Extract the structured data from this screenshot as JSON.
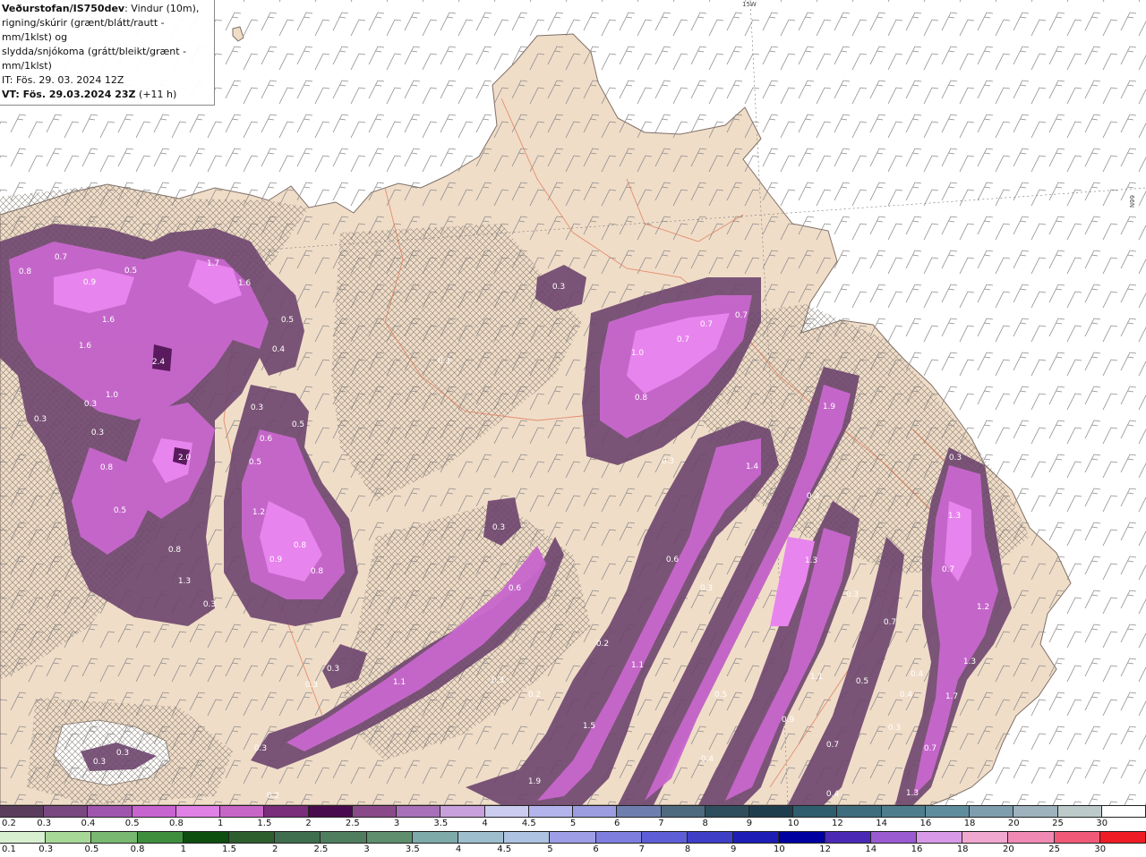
{
  "header": {
    "title": "Veðurstofan/IS750dev",
    "desc1": ": Vindur (10m),",
    "desc2": "rigning/skúrir (grænt/blátt/rautt - mm/1klst) og",
    "desc3": "slydda/snjókoma (grátt/bleikt/grænt - mm/1klst)",
    "it": "IT: Fös. 29. 03. 2024 12Z",
    "vt_label": "VT: Fös. 29.03.2024 23Z",
    "vt_lead": "(+11 h)"
  },
  "grid_labels": {
    "lon": "15W",
    "lat": "66N"
  },
  "precip_values": [
    {
      "v": "0.8"
    },
    {
      "v": "0.7"
    },
    {
      "v": "0.5"
    },
    {
      "v": "0.9"
    },
    {
      "v": "1.7"
    },
    {
      "v": "1.6"
    },
    {
      "v": "1.6"
    },
    {
      "v": "1.6"
    },
    {
      "v": "0.5"
    },
    {
      "v": "0.4"
    },
    {
      "v": "2.4"
    },
    {
      "v": "1.0"
    },
    {
      "v": "0.3"
    },
    {
      "v": "0.3"
    },
    {
      "v": "0.3"
    },
    {
      "v": "0.3"
    },
    {
      "v": "0.5"
    },
    {
      "v": "0.6"
    },
    {
      "v": "2.0"
    },
    {
      "v": "0.8"
    },
    {
      "v": "0.5"
    },
    {
      "v": "0.5"
    },
    {
      "v": "1.2"
    },
    {
      "v": "0.8"
    },
    {
      "v": "0.9"
    },
    {
      "v": "0.8"
    },
    {
      "v": "0.8"
    },
    {
      "v": "1.3"
    },
    {
      "v": "0.3"
    },
    {
      "v": "0.3"
    },
    {
      "v": "0.3"
    },
    {
      "v": "0.3"
    },
    {
      "v": "0.7"
    },
    {
      "v": "0.7"
    },
    {
      "v": "0.7"
    },
    {
      "v": "1.0"
    },
    {
      "v": "0.8"
    },
    {
      "v": "1.9"
    },
    {
      "v": "0.3"
    },
    {
      "v": "1.4"
    },
    {
      "v": "0.4"
    },
    {
      "v": "0.6"
    },
    {
      "v": "0.3"
    },
    {
      "v": "1.3"
    },
    {
      "v": "0.3"
    },
    {
      "v": "0.3"
    },
    {
      "v": "0.6"
    },
    {
      "v": "1.3"
    },
    {
      "v": "0.7"
    },
    {
      "v": "1.2"
    },
    {
      "v": "0.7"
    },
    {
      "v": "0.2"
    },
    {
      "v": "1.1"
    },
    {
      "v": "0.3"
    },
    {
      "v": "0.3"
    },
    {
      "v": "1.1"
    },
    {
      "v": "0.3"
    },
    {
      "v": "0.2"
    },
    {
      "v": "0.5"
    },
    {
      "v": "1.1"
    },
    {
      "v": "0.5"
    },
    {
      "v": "0.4"
    },
    {
      "v": "0.4"
    },
    {
      "v": "1.3"
    },
    {
      "v": "1.7"
    },
    {
      "v": "0.3"
    },
    {
      "v": "1.5"
    },
    {
      "v": "0.9"
    },
    {
      "v": "0.7"
    },
    {
      "v": "0.7"
    },
    {
      "v": "0.3"
    },
    {
      "v": "0.3"
    },
    {
      "v": "0.4"
    },
    {
      "v": "1.9"
    },
    {
      "v": "0.3"
    },
    {
      "v": "0.4"
    },
    {
      "v": "1.3"
    },
    {
      "v": "0.2"
    }
  ],
  "legend_snow": {
    "labels": [
      "0.2",
      "0.3",
      "0.4",
      "0.5",
      "0.8",
      "1",
      "1.5",
      "2",
      "2.5",
      "3",
      "3.5",
      "4",
      "4.5",
      "5",
      "6",
      "7",
      "8",
      "9",
      "10",
      "12",
      "14",
      "16",
      "18",
      "20",
      "25",
      "30"
    ],
    "colors": [
      "#5a3d5c",
      "#7a4880",
      "#a055ad",
      "#c864d0",
      "#e081e6",
      "#c866c8",
      "#7a2d7a",
      "#4a0a4e",
      "#8a4a8a",
      "#a870b8",
      "#c8a0dc",
      "#ccccf0",
      "#b4b4ec",
      "#9c9ce0",
      "#6e7eae",
      "#4e6a7e",
      "#2e4e5e",
      "#1e3e4e",
      "#2e5e6e",
      "#3e6e7e",
      "#4e7e8e",
      "#5e8e9e",
      "#7e9eae",
      "#9eb2be",
      "#bccaca",
      "#ffffff"
    ]
  },
  "legend_rain": {
    "labels": [
      "0.1",
      "0.3",
      "0.5",
      "0.8",
      "1",
      "1.5",
      "2",
      "2.5",
      "3",
      "3.5",
      "4",
      "4.5",
      "5",
      "6",
      "7",
      "8",
      "9",
      "10",
      "12",
      "14",
      "16",
      "18",
      "20",
      "25",
      "30"
    ],
    "colors": [
      "#d8f0d0",
      "#a8d898",
      "#78b870",
      "#3e8e3e",
      "#0e4e0e",
      "#2e5e2e",
      "#3e6e4e",
      "#4e7e5e",
      "#5e8e6e",
      "#7eaaaa",
      "#9ebece",
      "#aec2e2",
      "#9e9ee6",
      "#7e7ede",
      "#5e5ed6",
      "#3e3ec6",
      "#1e1eb6",
      "#0000a0",
      "#4a2ab4",
      "#9a5ad0",
      "#d89ae8",
      "#f0a8d0",
      "#f08ab4",
      "#f05a78",
      "#ee1c24"
    ]
  }
}
